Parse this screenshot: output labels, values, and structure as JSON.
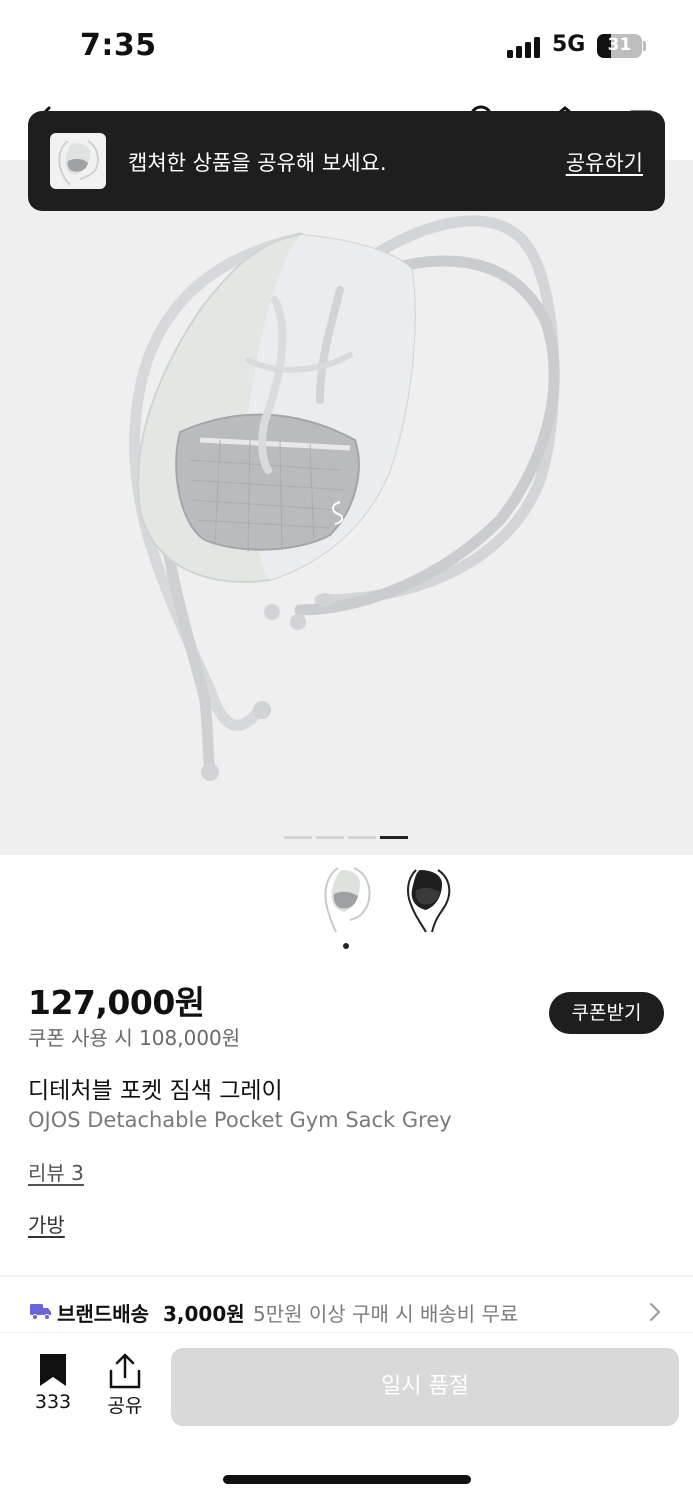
{
  "status_bar": {
    "time": "7:35",
    "network": "5G",
    "battery": "31",
    "battery_level": 0.31
  },
  "toast": {
    "message": "캡쳐한 상품을 공유해 보세요.",
    "action_label": "공유하기"
  },
  "gallery": {
    "image_count": 4,
    "active_index": 3,
    "thumbnails": [
      {
        "variant": "grey",
        "selected": true
      },
      {
        "variant": "black",
        "selected": false
      }
    ]
  },
  "product": {
    "price": "127,000원",
    "coupon_price": "쿠폰 사용 시 108,000원",
    "coupon_button": "쿠폰받기",
    "name": "디테처블 포켓 짐색 그레이",
    "name_en": "OJOS Detachable Pocket Gym Sack Grey",
    "review_link": "리뷰 3",
    "category_link": "가방"
  },
  "shipping": {
    "title": "브랜드배송",
    "price": "3,000원",
    "description": "5만원 이상 구매 시 배송비 무료"
  },
  "bottom_bar": {
    "bookmark_count": "333",
    "share_label": "공유",
    "buy_button": "일시 품절"
  },
  "colors": {
    "accent_dark": "#1e1e1e",
    "truck_icon": "#6b63d9",
    "disabled_button": "#d9d9d9",
    "hero_background": "#efefef"
  }
}
